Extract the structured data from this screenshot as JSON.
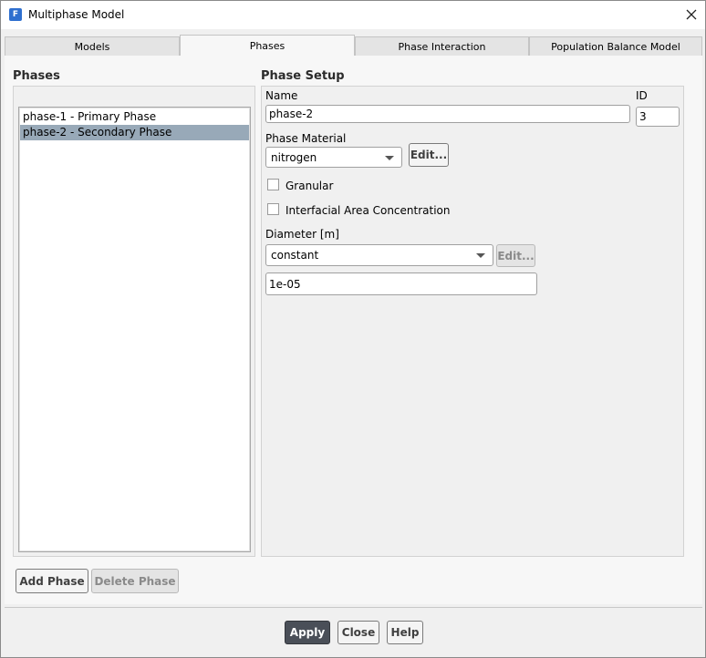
{
  "window": {
    "title": "Multiphase Model",
    "app_icon_letter": "F"
  },
  "tabs": [
    {
      "label": "Models"
    },
    {
      "label": "Phases"
    },
    {
      "label": "Phase Interaction"
    },
    {
      "label": "Population Balance Model"
    }
  ],
  "phases_panel": {
    "title": "Phases",
    "items": [
      {
        "label": "phase-1 - Primary Phase"
      },
      {
        "label": "phase-2 - Secondary Phase"
      }
    ],
    "add_label": "Add Phase",
    "delete_label": "Delete Phase"
  },
  "setup": {
    "title": "Phase Setup",
    "name_label": "Name",
    "name_value": "phase-2",
    "id_label": "ID",
    "id_value": "3",
    "material_label": "Phase Material",
    "material_value": "nitrogen",
    "material_edit": "Edit...",
    "granular_label": "Granular",
    "iac_label": "Interfacial Area Concentration",
    "diameter_label": "Diameter [m]",
    "diameter_method": "constant",
    "diameter_edit": "Edit...",
    "diameter_value": "1e-05"
  },
  "footer": {
    "apply_label": "Apply",
    "close_label": "Close",
    "help_label": "Help"
  }
}
